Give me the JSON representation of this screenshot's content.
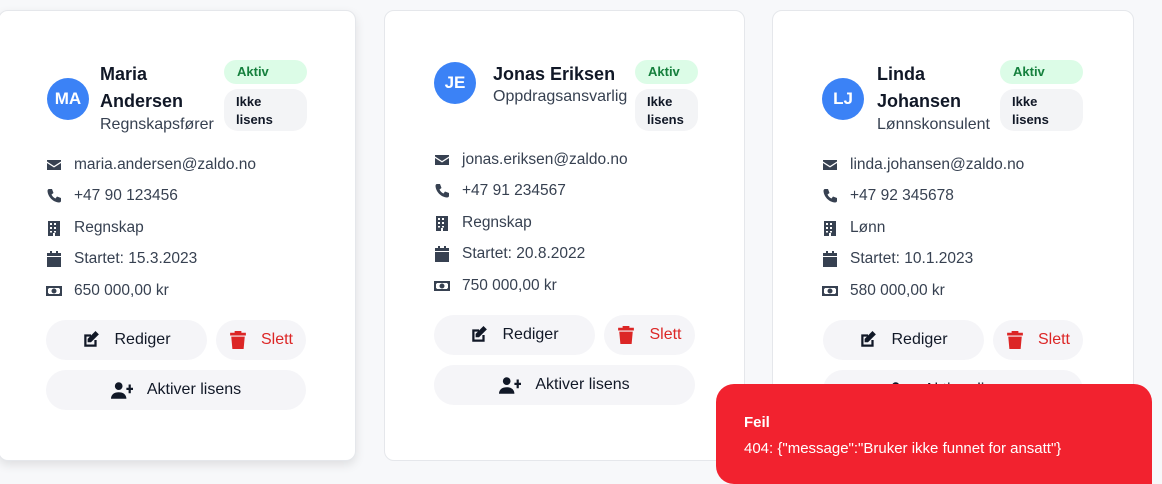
{
  "colors": {
    "accent": "#3b82f6",
    "active_bg": "#dcfce7",
    "active_text": "#15803d",
    "danger": "#dc2626",
    "toast": "#f2222f"
  },
  "employees": [
    {
      "initials": "MA",
      "name_line1": "Maria",
      "name_line2": "Andersen",
      "role": "Regnskapsfører",
      "status": "Aktiv",
      "license": "Ikke lisens",
      "email": "maria.andersen@zaldo.no",
      "phone": "+47 90 123456",
      "department": "Regnskap",
      "started": "Startet: 15.3.2023",
      "salary": "650 000,00 kr"
    },
    {
      "initials": "JE",
      "name_line1": "Jonas Eriksen",
      "role": "Oppdragsansvarlig",
      "status": "Aktiv",
      "license": "Ikke lisens",
      "email": "jonas.eriksen@zaldo.no",
      "phone": "+47 91 234567",
      "department": "Regnskap",
      "started": "Startet: 20.8.2022",
      "salary": "750 000,00 kr"
    },
    {
      "initials": "LJ",
      "name_line1": "Linda",
      "name_line2": "Johansen",
      "role": "Lønnskonsulent",
      "status": "Aktiv",
      "license": "Ikke lisens",
      "email": "linda.johansen@zaldo.no",
      "phone": "+47 92 345678",
      "department": "Lønn",
      "started": "Startet: 10.1.2023",
      "salary": "580 000,00 kr"
    }
  ],
  "actions": {
    "edit": "Rediger",
    "delete": "Slett",
    "activate_license": "Aktiver lisens"
  },
  "toast": {
    "title": "Feil",
    "message": "404: {\"message\":\"Bruker ikke funnet for ansatt\"}"
  }
}
